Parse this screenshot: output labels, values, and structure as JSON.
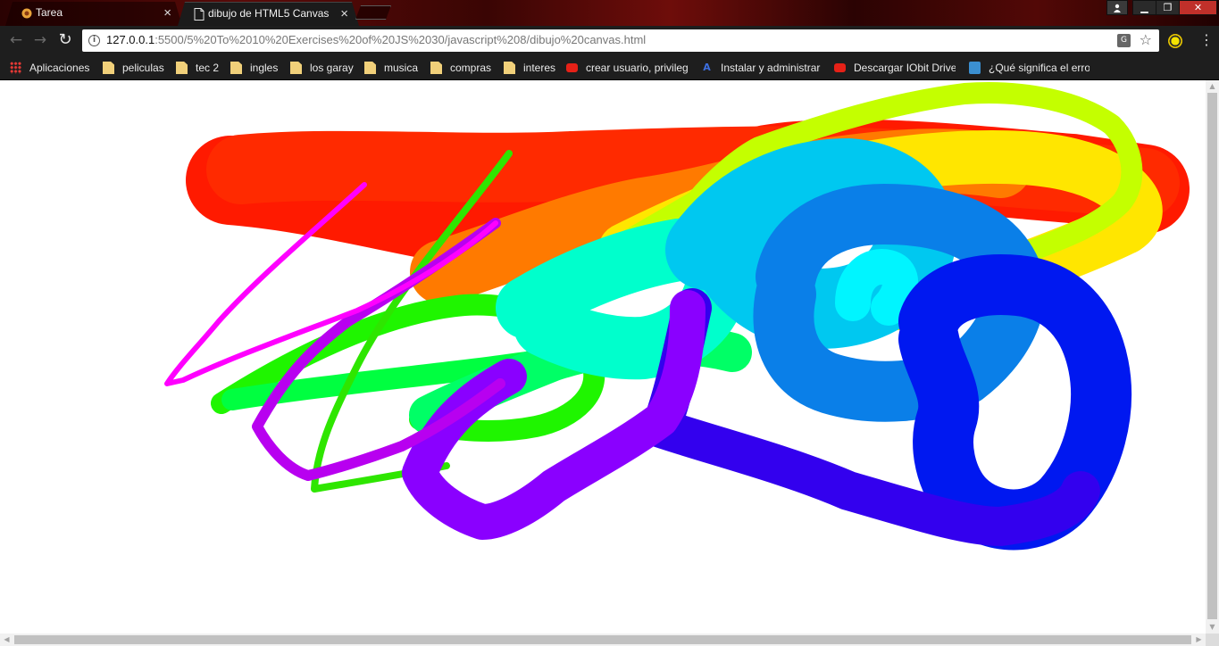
{
  "tabs": [
    {
      "label": "Tarea",
      "active": false,
      "icon": "tarea-favicon-icon"
    },
    {
      "label": "dibujo de HTML5 Canvas",
      "active": true,
      "icon": "page-icon"
    }
  ],
  "address_bar": {
    "host": "127.0.0.1",
    "path": ":5500/5%20To%2010%20Exercises%20of%20JS%2030/javascript%208/dibujo%20canvas.html"
  },
  "bookmarks": [
    {
      "label": "Aplicaciones",
      "icon": "apps-grid-icon"
    },
    {
      "label": "peliculas",
      "icon": "folder-icon"
    },
    {
      "label": "tec 2",
      "icon": "folder-icon"
    },
    {
      "label": "ingles",
      "icon": "folder-icon"
    },
    {
      "label": "los garay",
      "icon": "folder-icon"
    },
    {
      "label": "musica",
      "icon": "folder-icon"
    },
    {
      "label": "compras",
      "icon": "folder-icon"
    },
    {
      "label": "interes",
      "icon": "folder-icon"
    },
    {
      "label": "crear usuario, privileg",
      "icon": "youtube-icon"
    },
    {
      "label": "Instalar y administrar",
      "icon": "a-logo-icon"
    },
    {
      "label": "Descargar IObit Driver",
      "icon": "youtube-icon"
    },
    {
      "label": "¿Qué significa el error",
      "icon": "bookmark-site-icon"
    }
  ],
  "colors": {
    "titlebar": "#5a0a08",
    "toolbar": "#1e1e1e",
    "close_button": "#c0302a",
    "canvas_background": "#ffffff"
  },
  "canvas": {
    "description_hue_order": [
      "red",
      "orange",
      "yellow",
      "lime",
      "green",
      "cyan",
      "blue",
      "violet",
      "magenta"
    ]
  }
}
